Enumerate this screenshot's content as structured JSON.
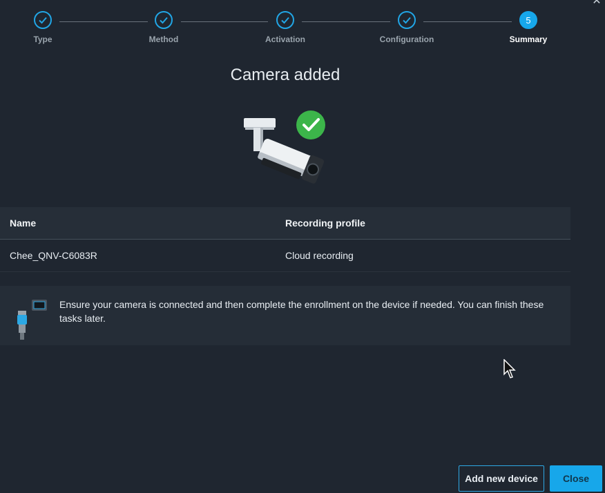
{
  "stepper": {
    "steps": [
      {
        "label": "Type",
        "state": "done"
      },
      {
        "label": "Method",
        "state": "done"
      },
      {
        "label": "Activation",
        "state": "done"
      },
      {
        "label": "Configuration",
        "state": "done"
      },
      {
        "label": "Summary",
        "state": "active",
        "number": "5"
      }
    ]
  },
  "title": "Camera added",
  "table": {
    "headers": [
      "Name",
      "Recording profile"
    ],
    "rows": [
      [
        "Chee_QNV-C6083R",
        "Cloud recording"
      ]
    ]
  },
  "info": {
    "icon": "network-cable-icon",
    "text": "Ensure your camera is connected and then complete the enrollment on the device if needed. You can finish these tasks later."
  },
  "buttons": {
    "add_new_device": "Add new device",
    "close": "Close"
  },
  "colors": {
    "accent": "#17a7ea",
    "background": "#1f2630",
    "success": "#3cb54a"
  }
}
